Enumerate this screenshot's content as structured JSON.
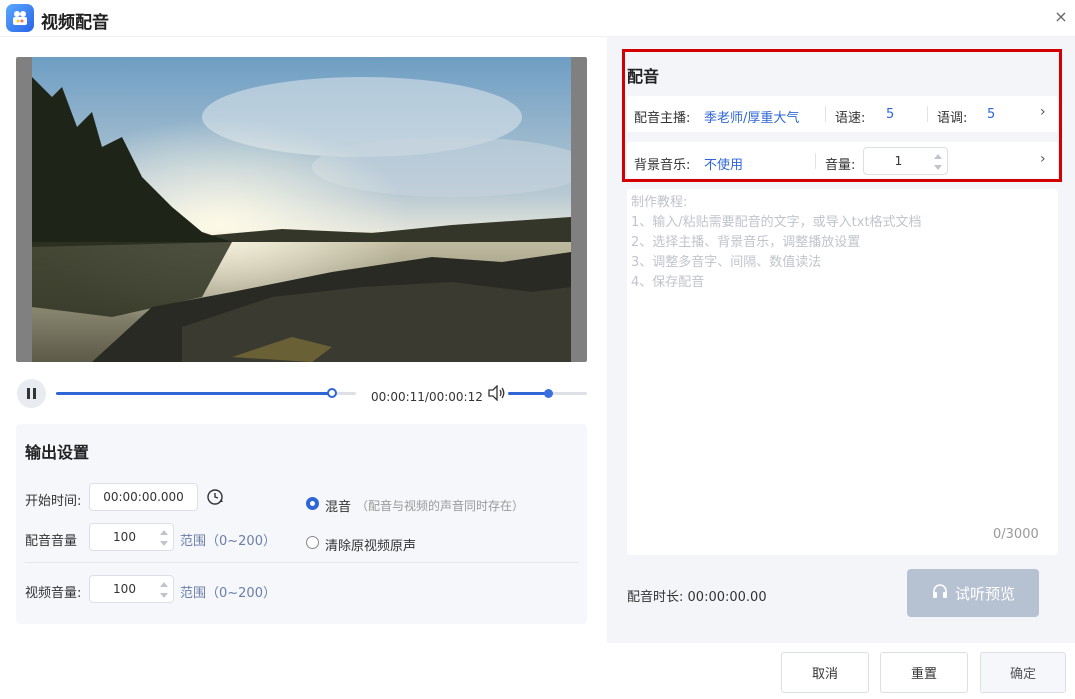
{
  "window": {
    "title": "视频配音",
    "close_glyph": "×"
  },
  "player": {
    "time": "00:00:11/00:00:12",
    "progress": 0.92,
    "volume": 0.5
  },
  "output": {
    "title": "输出设置",
    "start_time_label": "开始时间:",
    "start_time_value": "00:00:00.000",
    "dub_volume_label": "配音音量",
    "dub_volume_value": "100",
    "dub_volume_range": "范围（0~200）",
    "video_volume_label": "视频音量:",
    "video_volume_value": "100",
    "video_volume_range": "范围（0~200）",
    "mix_label": "混音",
    "mix_hint": "（配音与视频的声音同时存在）",
    "clear_label": "清除原视频原声"
  },
  "dubbing": {
    "title": "配音",
    "anchor_label": "配音主播:",
    "anchor_value": "季老师/厚重大气",
    "speed_label": "语速:",
    "speed_value": "5",
    "tone_label": "语调:",
    "tone_value": "5",
    "bgm_label": "背景音乐:",
    "bgm_value": "不使用",
    "bgm_volume_label": "音量:",
    "bgm_volume_value": "1",
    "chevron": "›"
  },
  "tutorial": {
    "lines": [
      "制作教程:",
      "1、输入/粘贴需要配音的文字，或导入txt格式文档",
      "2、选择主播、背景音乐，调整播放设置",
      "3、调整多音字、间隔、数值读法",
      "4、保存配音"
    ],
    "counter": "0/3000"
  },
  "duration": {
    "label": "配音时长:",
    "value": "00:00:00.00"
  },
  "preview_button": "试听预览",
  "footer": {
    "cancel": "取消",
    "reset": "重置",
    "confirm": "确定"
  },
  "colors": {
    "accent": "#2f66d6",
    "highlight_border": "#d40000"
  }
}
